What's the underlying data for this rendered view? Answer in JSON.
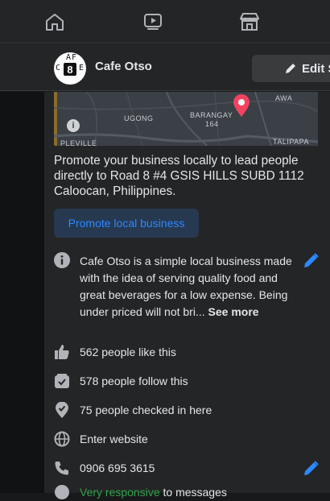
{
  "nav": {
    "items": [
      {
        "name": "home-icon"
      },
      {
        "name": "watch-icon"
      },
      {
        "name": "marketplace-icon"
      }
    ]
  },
  "page": {
    "name": "Cafe Otso",
    "edit_label": "Edit S",
    "logo_text": [
      "A",
      "F",
      "C",
      "E",
      "8"
    ]
  },
  "map": {
    "labels": [
      "AWA",
      "UGONG",
      "BARANGAY",
      "164",
      "TALIPAPA",
      "PLEVILLE"
    ]
  },
  "promo": {
    "text": "Promote your business locally to lead people directly to Road 8 #4 GSIS HILLS SUBD 1112 Caloocan, Philippines.",
    "button": "Promote local business"
  },
  "about": {
    "description": "Cafe Otso is a simple local business made with the idea of serving quality food and great beverages for a low expense. Being under priced will not bri...",
    "see_more": "See more"
  },
  "stats": {
    "likes": "562 people like this",
    "follows": "578 people follow this",
    "checkins": "75 people checked in here",
    "website": "Enter website",
    "phone": "0906 695 3615",
    "responsive_green": "Very responsive",
    "responsive_rest": " to messages"
  },
  "colors": {
    "background": "#18191a",
    "card": "#242526",
    "accent": "#2d88ff",
    "pin": "#f3425f",
    "green": "#31a24c"
  }
}
